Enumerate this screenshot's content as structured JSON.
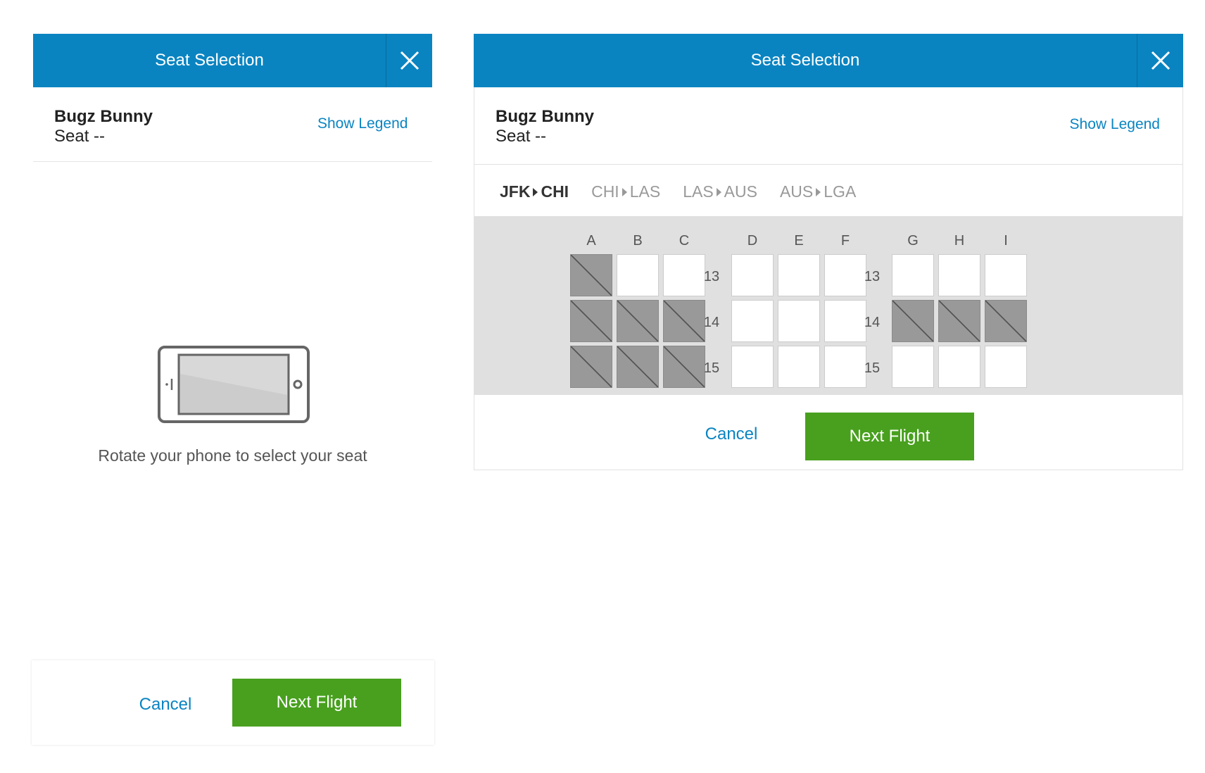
{
  "left": {
    "header": {
      "title": "Seat Selection"
    },
    "passenger": {
      "name": "Bugz Bunny",
      "seat": "Seat --"
    },
    "show_legend": "Show Legend",
    "rotate_message": "Rotate your phone to select your seat",
    "footer": {
      "cancel": "Cancel",
      "next": "Next Flight"
    }
  },
  "right": {
    "header": {
      "title": "Seat Selection"
    },
    "passenger": {
      "name": "Bugz Bunny",
      "seat": "Seat --"
    },
    "show_legend": "Show Legend",
    "flights": [
      {
        "from": "JFK",
        "to": "CHI",
        "active": true
      },
      {
        "from": "CHI",
        "to": "LAS",
        "active": false
      },
      {
        "from": "LAS",
        "to": "AUS",
        "active": false
      },
      {
        "from": "AUS",
        "to": "LGA",
        "active": false
      }
    ],
    "seat_map": {
      "columns": [
        "A",
        "B",
        "C",
        "D",
        "E",
        "F",
        "G",
        "H",
        "I"
      ],
      "rows": [
        {
          "number": "13",
          "taken": [
            "A"
          ]
        },
        {
          "number": "14",
          "taken": [
            "A",
            "B",
            "C",
            "G",
            "H",
            "I"
          ]
        },
        {
          "number": "15",
          "taken": [
            "A",
            "B",
            "C"
          ]
        }
      ]
    },
    "footer": {
      "cancel": "Cancel",
      "next": "Next Flight"
    }
  },
  "colors": {
    "header": "#0a84c1",
    "next_button": "#48a01e",
    "link": "#0a84c1",
    "seat_taken": "#999999",
    "seat_map_bg": "#e0e0e0"
  }
}
